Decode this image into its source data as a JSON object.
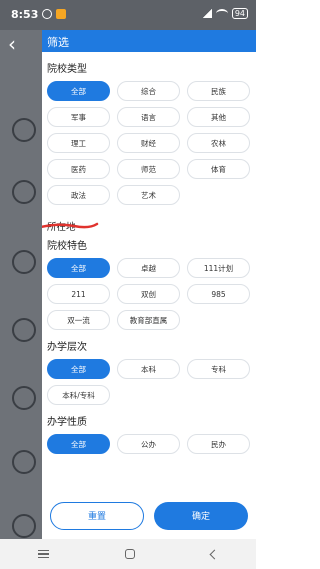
{
  "status_bar": {
    "time": "8:53",
    "battery": "94"
  },
  "drawer": {
    "title": "筛选",
    "sections": {
      "school_type": {
        "title": "院校类型",
        "chips": [
          "全部",
          "综合",
          "民族",
          "军事",
          "语言",
          "其他",
          "理工",
          "财经",
          "农林",
          "医药",
          "师范",
          "体育",
          "政法",
          "艺术"
        ],
        "selected": "全部"
      },
      "location": {
        "title": "所在地"
      },
      "school_feature": {
        "title": "院校特色",
        "chips": [
          "全部",
          "卓越",
          "111计划",
          "211",
          "双创",
          "985",
          "双一流",
          "教育部直属"
        ],
        "selected": "全部"
      },
      "education_level": {
        "title": "办学层次",
        "chips": [
          "全部",
          "本科",
          "专科",
          "本科/专科"
        ],
        "selected": "全部"
      },
      "school_nature": {
        "title": "办学性质",
        "chips": [
          "全部",
          "公办",
          "民办"
        ],
        "selected": "全部"
      }
    },
    "footer": {
      "reset_label": "重置",
      "confirm_label": "确定"
    }
  },
  "colors": {
    "accent": "#1f7ae0",
    "annotation_red": "#e0332e"
  },
  "icons": {
    "back": "chevron-left-icon",
    "nav_menu": "menu-icon",
    "nav_home": "home-icon",
    "nav_back": "back-triangle-icon"
  }
}
